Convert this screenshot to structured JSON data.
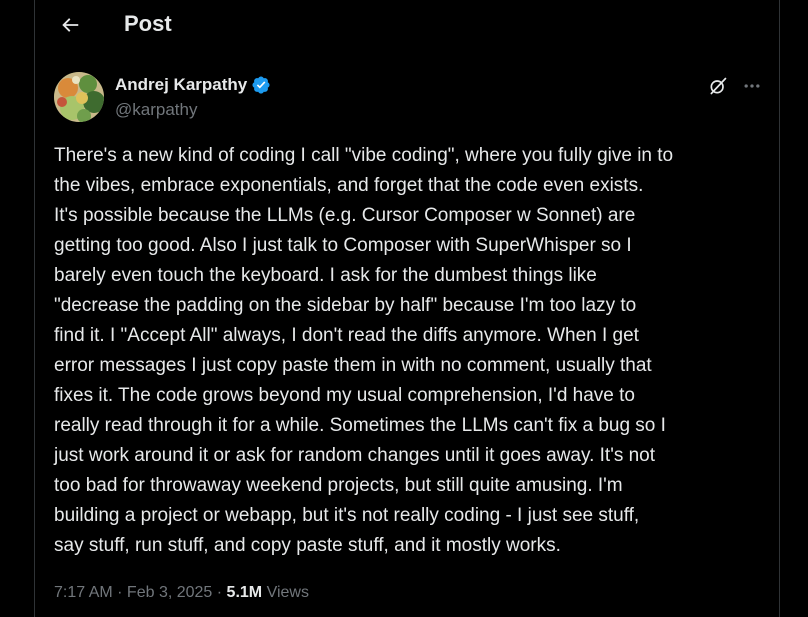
{
  "header": {
    "title": "Post",
    "back_icon": "arrow-left-icon"
  },
  "author": {
    "name": "Andrej Karpathy",
    "handle": "@karpathy",
    "verified": true,
    "verified_color": "#1d9bf0"
  },
  "actions": {
    "grok_icon": "grok-icon",
    "more_icon": "more-horizontal-icon"
  },
  "tweet": {
    "text": "There's a new kind of coding I call \"vibe coding\", where you fully give in to\nthe vibes, embrace exponentials, and forget that the code even exists.\nIt's possible because the LLMs (e.g. Cursor Composer w Sonnet) are\ngetting too good. Also I just talk to Composer with SuperWhisper so I\nbarely even touch the keyboard. I ask for the dumbest things like\n\"decrease the padding on the sidebar by half\" because I'm too lazy to\nfind it. I \"Accept All\" always, I don't read the diffs anymore. When I get\nerror messages I just copy paste them in with no comment, usually that\nfixes it. The code grows beyond my usual comprehension, I'd have to\nreally read through it for a while. Sometimes the LLMs can't fix a bug so I\njust work around it or ask for random changes until it goes away. It's not\ntoo bad for throwaway weekend projects, but still quite amusing. I'm\nbuilding a project or webapp, but it's not really coding - I just see stuff,\nsay stuff, run stuff, and copy paste stuff, and it mostly works."
  },
  "meta": {
    "time": "7:17 AM",
    "separator": " · ",
    "date": "Feb 3, 2025",
    "views_count": "5.1M",
    "views_label": " Views"
  },
  "colors": {
    "background": "#000000",
    "text_primary": "#e7e9ea",
    "text_secondary": "#71767b",
    "border": "#2f3336",
    "accent": "#1d9bf0"
  }
}
